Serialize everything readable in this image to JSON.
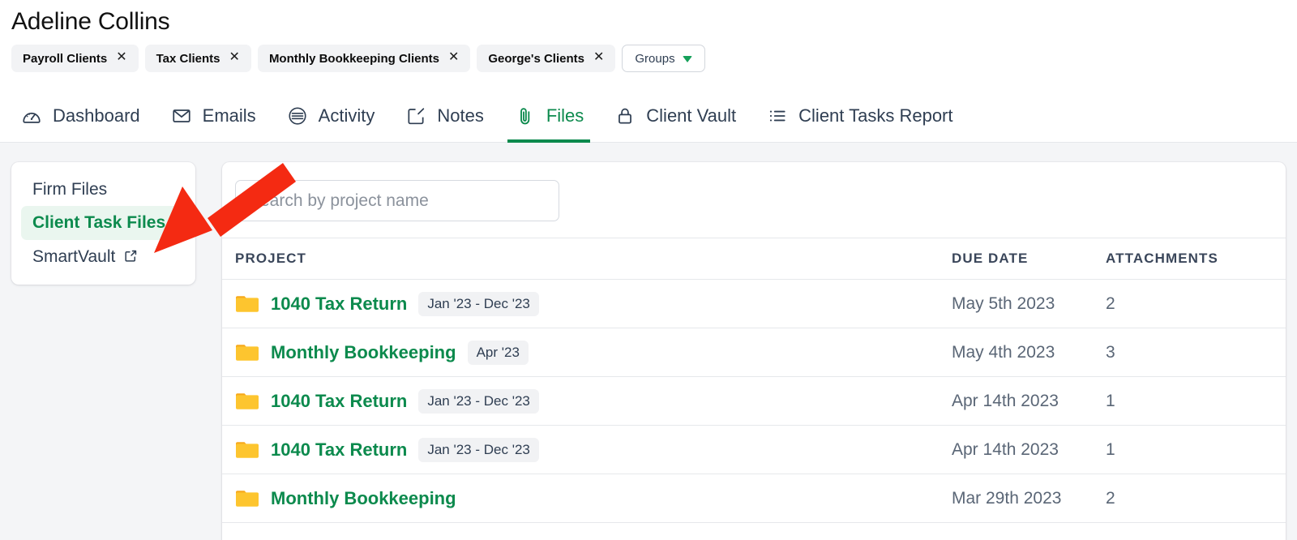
{
  "header": {
    "title": "Adeline Collins",
    "chips": [
      {
        "label": "Payroll Clients",
        "close": "✕"
      },
      {
        "label": "Tax Clients",
        "close": "✕"
      },
      {
        "label": "Monthly Bookkeeping Clients",
        "close": "✕"
      },
      {
        "label": "George's Clients",
        "close": "✕"
      }
    ],
    "groups_button": "Groups"
  },
  "tabs": [
    {
      "label": "Dashboard",
      "icon": "gauge-icon",
      "active": false
    },
    {
      "label": "Emails",
      "icon": "envelope-icon",
      "active": false
    },
    {
      "label": "Activity",
      "icon": "activity-list-icon",
      "active": false
    },
    {
      "label": "Notes",
      "icon": "note-edit-icon",
      "active": false
    },
    {
      "label": "Files",
      "icon": "paperclip-icon",
      "active": true
    },
    {
      "label": "Client Vault",
      "icon": "lock-icon",
      "active": false
    },
    {
      "label": "Client Tasks Report",
      "icon": "list-icon",
      "active": false
    }
  ],
  "sidebar": {
    "items": [
      {
        "label": "Firm Files",
        "active": false,
        "external": false
      },
      {
        "label": "Client Task Files",
        "active": true,
        "external": false
      },
      {
        "label": "SmartVault",
        "active": false,
        "external": true
      }
    ]
  },
  "search": {
    "value": "",
    "placeholder": "Search by project name"
  },
  "table": {
    "columns": [
      "PROJECT",
      "DUE DATE",
      "ATTACHMENTS"
    ],
    "rows": [
      {
        "project": "1040 Tax Return",
        "period": "Jan '23 - Dec '23",
        "due_date": "May 5th 2023",
        "attachments": "2"
      },
      {
        "project": "Monthly Bookkeeping",
        "period": "Apr '23",
        "due_date": "May 4th 2023",
        "attachments": "3"
      },
      {
        "project": "1040 Tax Return",
        "period": "Jan '23 - Dec '23",
        "due_date": "Apr 14th 2023",
        "attachments": "1"
      },
      {
        "project": "1040 Tax Return",
        "period": "Jan '23 - Dec '23",
        "due_date": "Apr 14th 2023",
        "attachments": "1"
      },
      {
        "project": "Monthly Bookkeeping",
        "period": "",
        "due_date": "Mar 29th 2023",
        "attachments": "2"
      }
    ]
  },
  "annotation": {
    "type": "red-arrow",
    "color": "#f42a12",
    "points_to": "Client Task Files"
  },
  "colors": {
    "accent_green": "#0c8a4d",
    "folder_yellow": "#fdc52f",
    "page_bg": "#f4f5f7",
    "text_dark": "#2f3e52",
    "arrow_red": "#f42a12"
  }
}
